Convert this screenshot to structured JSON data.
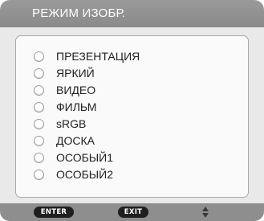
{
  "header": {
    "title": "РЕЖИМ ИЗОБР."
  },
  "options": [
    {
      "label": "ПРЕЗЕНТАЦИЯ"
    },
    {
      "label": "ЯРКИЙ"
    },
    {
      "label": "ВИДЕО"
    },
    {
      "label": "ФИЛЬМ"
    },
    {
      "label": "sRGB"
    },
    {
      "label": "ДОСКА"
    },
    {
      "label": "ОСОБЫЙ1"
    },
    {
      "label": "ОСОБЫЙ2"
    }
  ],
  "footer": {
    "enter_label": "ENTER",
    "exit_label": "EXIT",
    "nav_icon": "up-down-arrows-icon"
  },
  "colors": {
    "title_bar": "#8f8f8f",
    "panel_bg": "#fafafa",
    "footer_bg": "#8e8e8e"
  }
}
